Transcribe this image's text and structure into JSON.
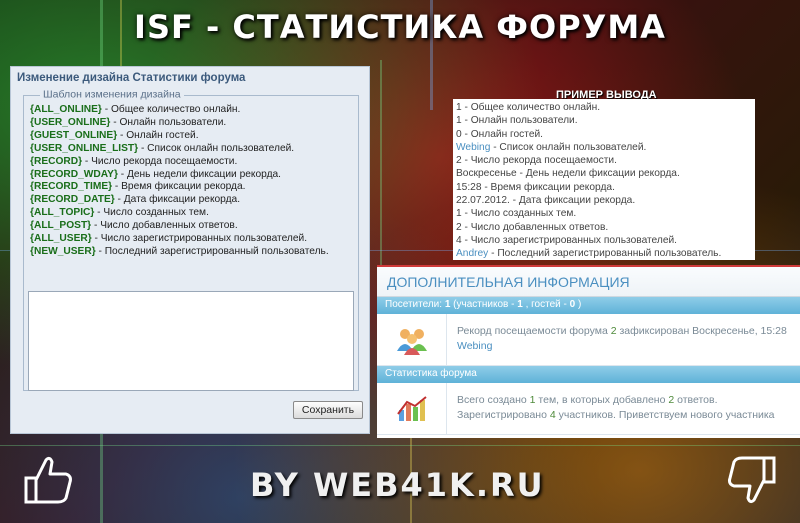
{
  "banner": {
    "title": "ISF - СТАТИСТИКА ФОРУМА",
    "footer": "BY WEB41K.RU"
  },
  "design_panel": {
    "title": "Изменение дизайна Статистики форума",
    "fieldset_legend": "Шаблон изменения дизайна",
    "variables": [
      {
        "token": "{ALL_ONLINE}",
        "desc": " - Общее количество онлайн."
      },
      {
        "token": "{USER_ONLINE}",
        "desc": " - Онлайн пользователи."
      },
      {
        "token": "{GUEST_ONLINE}",
        "desc": " - Онлайн гостей."
      },
      {
        "token": "{USER_ONLINE_LIST}",
        "desc": " - Список онлайн пользователей."
      },
      {
        "token": "{RECORD}",
        "desc": " - Число рекорда посещаемости."
      },
      {
        "token": "{RECORD_WDAY}",
        "desc": " - День недели фиксации рекорда."
      },
      {
        "token": "{RECORD_TIME}",
        "desc": " - Время фиксации рекорда."
      },
      {
        "token": "{RECORD_DATE}",
        "desc": " - Дата фиксации рекорда."
      },
      {
        "token": "{ALL_TOPIC}",
        "desc": " - Число созданных тем."
      },
      {
        "token": "{ALL_POST}",
        "desc": " - Число добавленных ответов."
      },
      {
        "token": "{ALL_USER}",
        "desc": " - Число зарегистрированных пользователей."
      },
      {
        "token": "{NEW_USER}",
        "desc": " - Последний зарегистрированный пользователь."
      }
    ],
    "textarea_value": "",
    "save_label": "Сохранить"
  },
  "example": {
    "heading": "ПРИМЕР ВЫВОДА",
    "lines": [
      {
        "user": "",
        "text": "1 - Общее количество онлайн."
      },
      {
        "user": "",
        "text": "1 - Онлайн пользователи."
      },
      {
        "user": "",
        "text": "0 - Онлайн гостей."
      },
      {
        "user": "Webing",
        "text": " - Список онлайн пользователей."
      },
      {
        "user": "",
        "text": "2 - Число рекорда посещаемости."
      },
      {
        "user": "",
        "text": "Воскресенье - День недели фиксации рекорда."
      },
      {
        "user": "",
        "text": "15:28 - Время фиксации рекорда."
      },
      {
        "user": "",
        "text": "22.07.2012. - Дата фиксации рекорда."
      },
      {
        "user": "",
        "text": "1 - Число созданных тем."
      },
      {
        "user": "",
        "text": "2 - Число добавленных ответов."
      },
      {
        "user": "",
        "text": "4 - Число зарегистрированных пользователей."
      },
      {
        "user": "Andrey",
        "text": " - Последний зарегистрированный пользователь."
      }
    ]
  },
  "info": {
    "title": "ДОПОЛНИТЕЛЬНАЯ ИНФОРМАЦИЯ",
    "visitors_bar": {
      "label": "Посетители:",
      "total": "1",
      "open": " (участников - ",
      "members": "1",
      "mid": ", гостей - ",
      "guests": "0",
      "close": ")"
    },
    "record_row": {
      "pre": "Рекорд посещаемости форума ",
      "count": "2",
      "mid": " зафиксирован Воскресенье, 15:28",
      "user": "Webing"
    },
    "stats_bar": "Статистика форума",
    "stats_row": {
      "l1_pre": "Всего создано ",
      "topics": "1",
      "l1_mid": " тем, в которых добавлено ",
      "posts": "2",
      "l1_post": " ответов.",
      "l2_pre": "Зарегистрировано ",
      "users": "4",
      "l2_post": " участников. Приветствуем нового участника"
    }
  },
  "icons": {
    "thumb_up": "thumbs-up-icon",
    "thumb_down": "thumbs-down-icon",
    "users": "users-group-icon",
    "chart": "stats-chart-icon"
  }
}
